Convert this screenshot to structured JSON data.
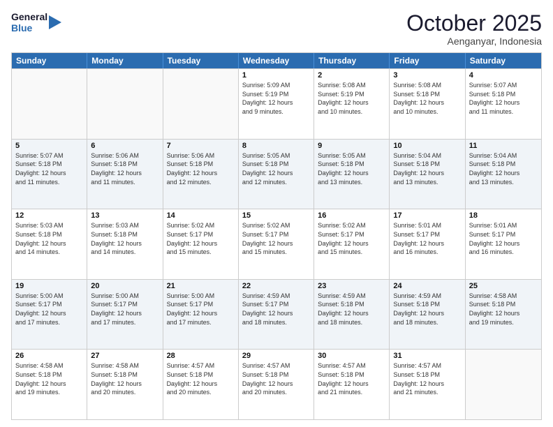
{
  "header": {
    "logo_line1": "General",
    "logo_line2": "Blue",
    "month": "October 2025",
    "location": "Aenganyar, Indonesia"
  },
  "days_of_week": [
    "Sunday",
    "Monday",
    "Tuesday",
    "Wednesday",
    "Thursday",
    "Friday",
    "Saturday"
  ],
  "weeks": [
    [
      {
        "day": "",
        "info": ""
      },
      {
        "day": "",
        "info": ""
      },
      {
        "day": "",
        "info": ""
      },
      {
        "day": "1",
        "info": "Sunrise: 5:09 AM\nSunset: 5:19 PM\nDaylight: 12 hours\nand 9 minutes."
      },
      {
        "day": "2",
        "info": "Sunrise: 5:08 AM\nSunset: 5:19 PM\nDaylight: 12 hours\nand 10 minutes."
      },
      {
        "day": "3",
        "info": "Sunrise: 5:08 AM\nSunset: 5:18 PM\nDaylight: 12 hours\nand 10 minutes."
      },
      {
        "day": "4",
        "info": "Sunrise: 5:07 AM\nSunset: 5:18 PM\nDaylight: 12 hours\nand 11 minutes."
      }
    ],
    [
      {
        "day": "5",
        "info": "Sunrise: 5:07 AM\nSunset: 5:18 PM\nDaylight: 12 hours\nand 11 minutes."
      },
      {
        "day": "6",
        "info": "Sunrise: 5:06 AM\nSunset: 5:18 PM\nDaylight: 12 hours\nand 11 minutes."
      },
      {
        "day": "7",
        "info": "Sunrise: 5:06 AM\nSunset: 5:18 PM\nDaylight: 12 hours\nand 12 minutes."
      },
      {
        "day": "8",
        "info": "Sunrise: 5:05 AM\nSunset: 5:18 PM\nDaylight: 12 hours\nand 12 minutes."
      },
      {
        "day": "9",
        "info": "Sunrise: 5:05 AM\nSunset: 5:18 PM\nDaylight: 12 hours\nand 13 minutes."
      },
      {
        "day": "10",
        "info": "Sunrise: 5:04 AM\nSunset: 5:18 PM\nDaylight: 12 hours\nand 13 minutes."
      },
      {
        "day": "11",
        "info": "Sunrise: 5:04 AM\nSunset: 5:18 PM\nDaylight: 12 hours\nand 13 minutes."
      }
    ],
    [
      {
        "day": "12",
        "info": "Sunrise: 5:03 AM\nSunset: 5:18 PM\nDaylight: 12 hours\nand 14 minutes."
      },
      {
        "day": "13",
        "info": "Sunrise: 5:03 AM\nSunset: 5:18 PM\nDaylight: 12 hours\nand 14 minutes."
      },
      {
        "day": "14",
        "info": "Sunrise: 5:02 AM\nSunset: 5:17 PM\nDaylight: 12 hours\nand 15 minutes."
      },
      {
        "day": "15",
        "info": "Sunrise: 5:02 AM\nSunset: 5:17 PM\nDaylight: 12 hours\nand 15 minutes."
      },
      {
        "day": "16",
        "info": "Sunrise: 5:02 AM\nSunset: 5:17 PM\nDaylight: 12 hours\nand 15 minutes."
      },
      {
        "day": "17",
        "info": "Sunrise: 5:01 AM\nSunset: 5:17 PM\nDaylight: 12 hours\nand 16 minutes."
      },
      {
        "day": "18",
        "info": "Sunrise: 5:01 AM\nSunset: 5:17 PM\nDaylight: 12 hours\nand 16 minutes."
      }
    ],
    [
      {
        "day": "19",
        "info": "Sunrise: 5:00 AM\nSunset: 5:17 PM\nDaylight: 12 hours\nand 17 minutes."
      },
      {
        "day": "20",
        "info": "Sunrise: 5:00 AM\nSunset: 5:17 PM\nDaylight: 12 hours\nand 17 minutes."
      },
      {
        "day": "21",
        "info": "Sunrise: 5:00 AM\nSunset: 5:17 PM\nDaylight: 12 hours\nand 17 minutes."
      },
      {
        "day": "22",
        "info": "Sunrise: 4:59 AM\nSunset: 5:17 PM\nDaylight: 12 hours\nand 18 minutes."
      },
      {
        "day": "23",
        "info": "Sunrise: 4:59 AM\nSunset: 5:18 PM\nDaylight: 12 hours\nand 18 minutes."
      },
      {
        "day": "24",
        "info": "Sunrise: 4:59 AM\nSunset: 5:18 PM\nDaylight: 12 hours\nand 18 minutes."
      },
      {
        "day": "25",
        "info": "Sunrise: 4:58 AM\nSunset: 5:18 PM\nDaylight: 12 hours\nand 19 minutes."
      }
    ],
    [
      {
        "day": "26",
        "info": "Sunrise: 4:58 AM\nSunset: 5:18 PM\nDaylight: 12 hours\nand 19 minutes."
      },
      {
        "day": "27",
        "info": "Sunrise: 4:58 AM\nSunset: 5:18 PM\nDaylight: 12 hours\nand 20 minutes."
      },
      {
        "day": "28",
        "info": "Sunrise: 4:57 AM\nSunset: 5:18 PM\nDaylight: 12 hours\nand 20 minutes."
      },
      {
        "day": "29",
        "info": "Sunrise: 4:57 AM\nSunset: 5:18 PM\nDaylight: 12 hours\nand 20 minutes."
      },
      {
        "day": "30",
        "info": "Sunrise: 4:57 AM\nSunset: 5:18 PM\nDaylight: 12 hours\nand 21 minutes."
      },
      {
        "day": "31",
        "info": "Sunrise: 4:57 AM\nSunset: 5:18 PM\nDaylight: 12 hours\nand 21 minutes."
      },
      {
        "day": "",
        "info": ""
      }
    ]
  ]
}
